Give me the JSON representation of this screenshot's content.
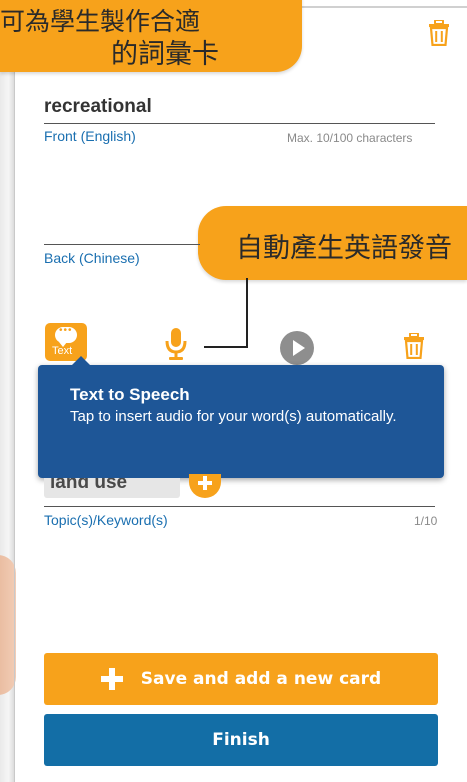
{
  "callouts": {
    "top_line1": "可為學生製作合適",
    "top_line2": "的詞彙卡",
    "middle": "自動產生英語發音"
  },
  "front": {
    "value": "recreational",
    "label": "Front (English)",
    "hint": "Max. 10/100 characters"
  },
  "back": {
    "label": "Back (Chinese)"
  },
  "audio_toolbar": {
    "text_button_label": "Text",
    "icons": [
      "speech-bubble-icon",
      "microphone-icon",
      "play-icon",
      "trash-icon"
    ]
  },
  "tooltip": {
    "title": "Text to Speech",
    "body": "Tap to insert audio for your word(s) automatically."
  },
  "keywords": {
    "chip": "land use",
    "label": "Topic(s)/Keyword(s)",
    "count": "1/10"
  },
  "buttons": {
    "save": "Save and add a new card",
    "finish": "Finish"
  },
  "colors": {
    "accent_orange": "#f7a21b",
    "label_blue": "#1a6fb0",
    "tooltip_blue": "#1e5697",
    "finish_blue": "#136ea6"
  }
}
